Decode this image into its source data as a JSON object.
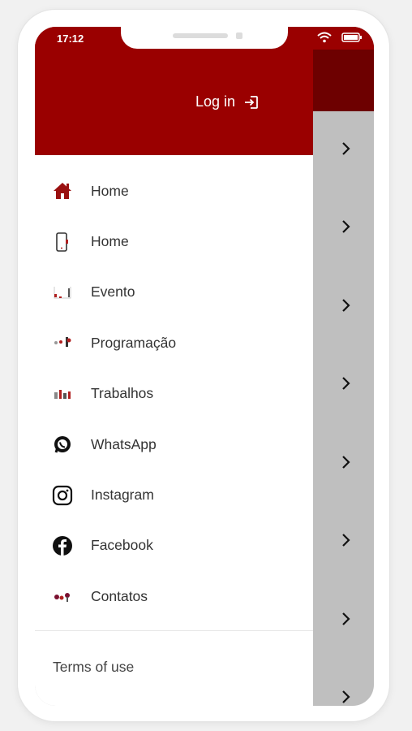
{
  "status_bar": {
    "time": "17:12"
  },
  "drawer": {
    "login_label": "Log in",
    "menu_items": [
      {
        "label": "Home",
        "icon": "home-icon"
      },
      {
        "label": "Home",
        "icon": "phone-icon"
      },
      {
        "label": "Evento",
        "icon": "event-icon"
      },
      {
        "label": "Programação",
        "icon": "schedule-icon"
      },
      {
        "label": "Trabalhos",
        "icon": "works-icon"
      },
      {
        "label": "WhatsApp",
        "icon": "whatsapp-icon"
      },
      {
        "label": "Instagram",
        "icon": "instagram-icon"
      },
      {
        "label": "Facebook",
        "icon": "facebook-icon"
      },
      {
        "label": "Contatos",
        "icon": "contacts-icon"
      }
    ],
    "terms_label": "Terms of use"
  },
  "colors": {
    "brand": "#9a0000",
    "brand_dark": "#6d0000",
    "overlay": "#bfbfbf"
  }
}
